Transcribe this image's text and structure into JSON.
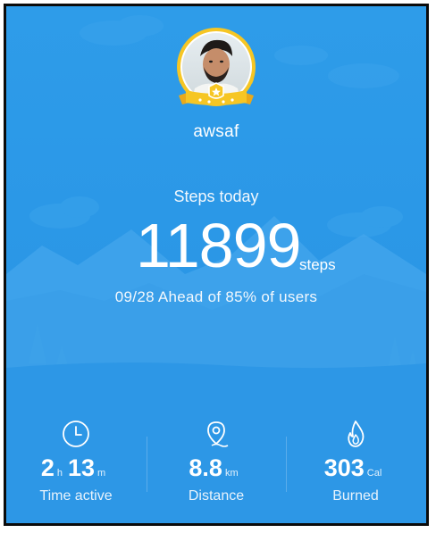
{
  "profile": {
    "username": "awsaf"
  },
  "steps": {
    "label": "Steps today",
    "value": "11899",
    "unit": "steps",
    "ranking_text": "09/28 Ahead of 85% of users"
  },
  "stats": {
    "time": {
      "hours": "2",
      "hours_unit": "h",
      "minutes": "13",
      "minutes_unit": "m",
      "caption": "Time active",
      "icon": "clock-icon"
    },
    "distance": {
      "value": "8.8",
      "unit": "km",
      "caption": "Distance",
      "icon": "location-pin-icon"
    },
    "calories": {
      "value": "303",
      "unit": "Cal",
      "caption": "Burned",
      "icon": "flame-icon"
    }
  },
  "colors": {
    "background": "#2b98e7",
    "badge_gold": "#f6c624",
    "mountain_light": "#4aa8ec",
    "mountain_dark": "#3ca0ea"
  }
}
